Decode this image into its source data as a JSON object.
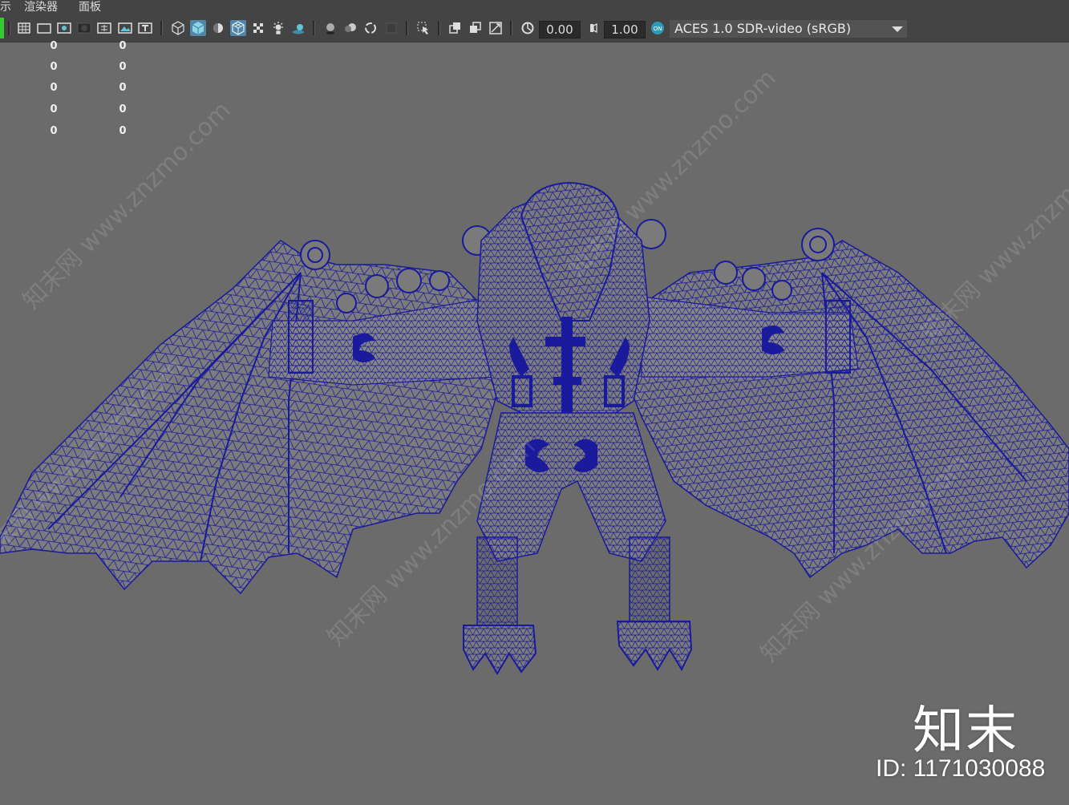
{
  "menu": {
    "items": [
      {
        "label": "示"
      },
      {
        "label": "渲染器"
      },
      {
        "label": "面板"
      }
    ]
  },
  "toolbar": {
    "exposure_value": "0.00",
    "gamma_value": "1.00",
    "color_space": "ACES 1.0 SDR-video (sRGB)",
    "icons": [
      "grid-icon",
      "film-gate-icon",
      "resolution-gate-icon",
      "gate-mask-icon",
      "field-chart-icon",
      "safe-action-icon",
      "safe-title-icon",
      "wireframe-cube-icon",
      "smooth-shade-icon",
      "shade-on-wireframe-icon",
      "xray-icon",
      "checker-icon",
      "lights-icon",
      "shadows-icon",
      "ambient-occlusion-icon",
      "motion-blur-icon",
      "antialias-icon",
      "depth-of-field-icon",
      "select-camera-icon",
      "isolate-icon",
      "xray-joints-icon",
      "snapshot-icon",
      "exposure-icon",
      "gamma-icon",
      "color-management-icon"
    ],
    "accent_color": "#5285a6"
  },
  "hud": {
    "rows": [
      {
        "a": "0",
        "b": "0"
      },
      {
        "a": "0",
        "b": "0"
      },
      {
        "a": "0",
        "b": "0"
      },
      {
        "a": "0",
        "b": "0"
      },
      {
        "a": "0",
        "b": "0"
      }
    ]
  },
  "viewport": {
    "background_color": "#6b6b6b",
    "wireframe_color": "#1a1a9c",
    "model": "winged-dragon-wireframe"
  },
  "watermark": {
    "repeating_text": "知末网 www.znzmo.com",
    "logo_text": "知末",
    "id_text": "ID: 1171030088"
  }
}
